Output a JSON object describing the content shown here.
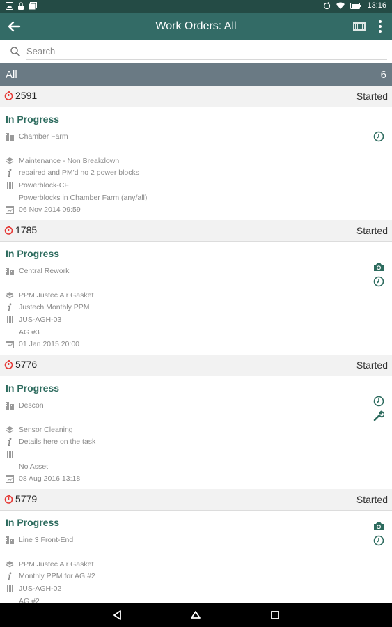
{
  "status_bar": {
    "time": "13:16"
  },
  "app_bar": {
    "title": "Work Orders: All"
  },
  "search": {
    "placeholder": "Search"
  },
  "group": {
    "label": "All",
    "count": "6"
  },
  "work_orders": [
    {
      "number": "2591",
      "status": "Started",
      "state": "In Progress",
      "location": "Chamber Farm",
      "type": "Maintenance -  Non Breakdown",
      "description": "repaired and PM'd no 2 power blocks",
      "asset_code": "Powerblock-CF",
      "asset_name": "Powerblocks in Chamber Farm (any/all)",
      "date": "06 Nov 2014 09:59",
      "side_icons": [
        "timer-icon"
      ]
    },
    {
      "number": "1785",
      "status": "Started",
      "state": "In Progress",
      "location": "Central Rework",
      "type": "PPM Justec Air Gasket",
      "description": "Justech Monthly PPM",
      "asset_code": "JUS-AGH-03",
      "asset_name": "AG  #3",
      "date": "01 Jan 2015 20:00",
      "side_icons": [
        "camera-icon",
        "timer-icon"
      ]
    },
    {
      "number": "5776",
      "status": "Started",
      "state": "In Progress",
      "location": "Descon",
      "type": "Sensor Cleaning",
      "description": "Details here on the task",
      "asset_code": "",
      "asset_name": "No Asset",
      "date": "08 Aug 2016 13:18",
      "side_icons": [
        "timer-icon",
        "wrench-icon"
      ]
    },
    {
      "number": "5779",
      "status": "Started",
      "state": "In Progress",
      "location": "Line 3 Front-End",
      "type": "PPM Justec Air Gasket",
      "description": "Monthly PPM for AG #2",
      "asset_code": "JUS-AGH-02",
      "asset_name": "AG  #2",
      "date": "",
      "side_icons": [
        "camera-icon",
        "timer-icon"
      ]
    }
  ],
  "colors": {
    "status_bar": "#244b45",
    "app_bar": "#336b66",
    "group_bar": "#6a7a84",
    "accent": "#2d6b5e",
    "clock_red": "#e53935"
  }
}
